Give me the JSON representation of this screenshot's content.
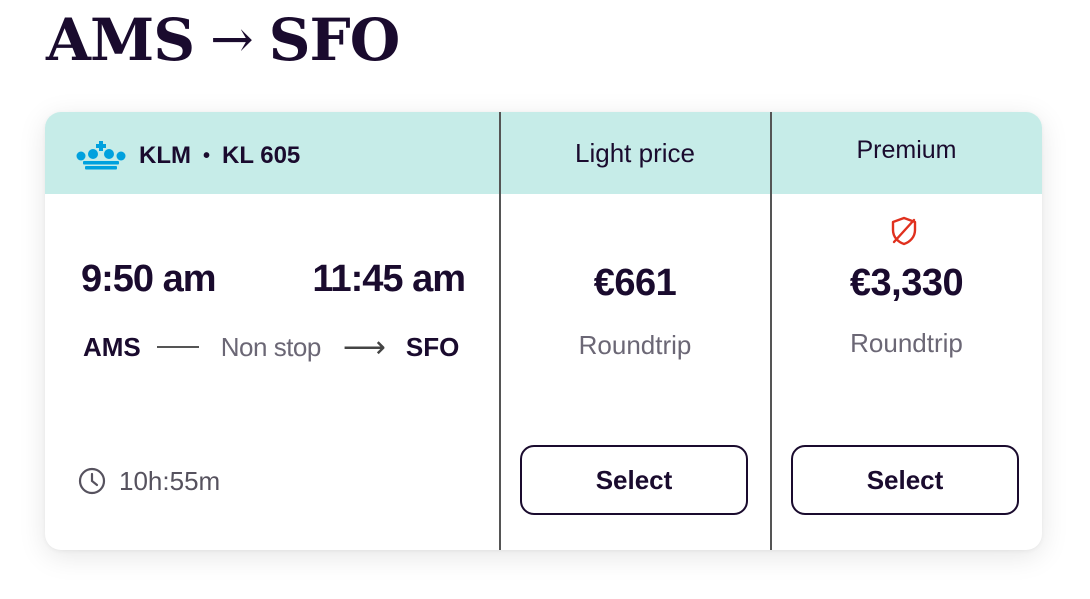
{
  "route": {
    "origin": "AMS",
    "arrow": "→",
    "destination": "SFO"
  },
  "flight": {
    "airline": "KLM",
    "separator": "•",
    "flight_number": "KL 605",
    "logo_icon": "klm-crown-icon",
    "departure_time": "9:50 am",
    "arrival_time": "11:45 am",
    "origin_code": "AMS",
    "stops": "Non stop",
    "destination_code": "SFO",
    "duration": "10h:55m",
    "duration_icon": "clock-icon"
  },
  "fares": [
    {
      "name": "Light price",
      "price": "€661",
      "trip_type": "Roundtrip",
      "button_label": "Select"
    },
    {
      "name": "Premium",
      "price": "€3,330",
      "trip_type": "Roundtrip",
      "button_label": "Select",
      "badge_icon": "shield-slash-icon"
    }
  ],
  "colors": {
    "header_band": "#c6ece8",
    "text_dark": "#1a0b2e",
    "text_muted": "#6b6775",
    "klm_blue": "#00a1de",
    "shield_red": "#e0301e"
  }
}
